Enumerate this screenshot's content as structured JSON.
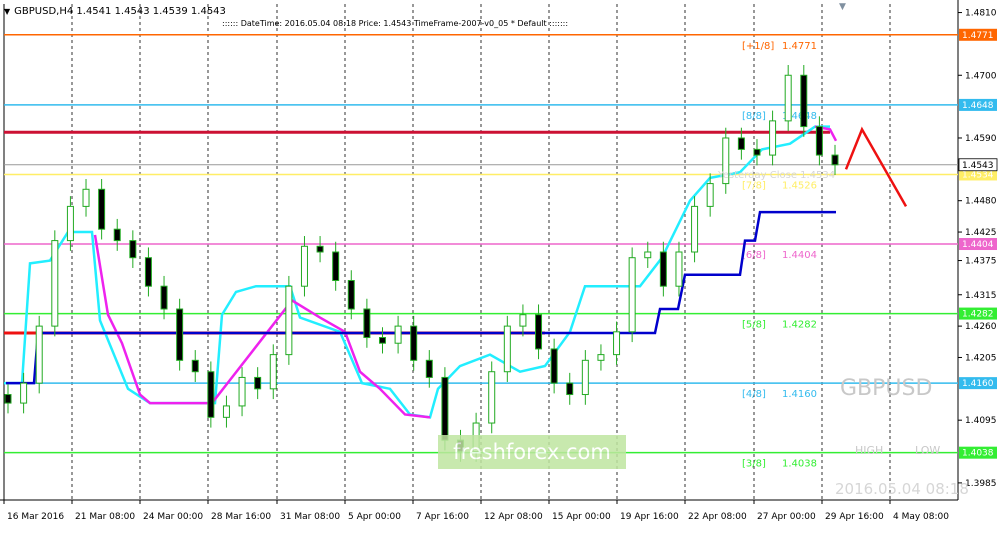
{
  "header": {
    "symbol_info": "GBPUSD,H4  1.4541 1.4543 1.4539 1.4543",
    "info_line": ":::::: DateTime: 2016.05.04 08:18   Price: 1.4543   TimeFrame-2007-v0_05   *   Default   :::::::"
  },
  "watermark": {
    "symbol": "GBPUSD",
    "timestamp": "2016.05.04 08:18",
    "high": "HIGH",
    "low": "LOW",
    "brand": "freshforex.com"
  },
  "price_axis": {
    "ticks": [
      "1.4810",
      "1.4700",
      "1.4590",
      "1.4480",
      "1.4375",
      "1.4315",
      "1.4260",
      "1.4205",
      "1.4095",
      "1.3985"
    ],
    "visible_ticks": [
      "1.4810",
      "1.4700",
      "1.4590",
      "1.4480",
      "1.4425",
      "1.4375",
      "1.4315",
      "1.4260",
      "1.4205",
      "1.4095",
      "1.3985"
    ]
  },
  "time_axis": {
    "labels": [
      "16 Mar 2016",
      "21 Mar 08:00",
      "24 Mar 00:00",
      "28 Mar 16:00",
      "31 Mar 08:00",
      "5 Apr 00:00",
      "7 Apr 16:00",
      "12 Apr 08:00",
      "15 Apr 00:00",
      "19 Apr 16:00",
      "22 Apr 08:00",
      "27 Apr 00:00",
      "29 Apr 16:00",
      "4 May 08:00"
    ]
  },
  "levels": [
    {
      "name": "[+1/8]",
      "value": "1.4771",
      "badge": "1.4771",
      "color": "#ff6600"
    },
    {
      "name": "[8/8]",
      "value": "1.4648",
      "badge": "1.4648",
      "color": "#33bbee"
    },
    {
      "name": "[7/8]",
      "value": "1.4526",
      "badge": "1.4534",
      "color": "#ffee66"
    },
    {
      "name": "[6/8]",
      "value": "1.4404",
      "badge": "1.4404",
      "color": "#ee66cc"
    },
    {
      "name": "[5/8]",
      "value": "1.4282",
      "badge": "1.4282",
      "color": "#33ee33"
    },
    {
      "name": "[4/8]",
      "value": "1.4160",
      "badge": "1.4160",
      "color": "#33bbee"
    },
    {
      "name": "[3/8]",
      "value": "1.4038",
      "badge": "1.4038",
      "color": "#33ee33"
    }
  ],
  "current_price_badge": "1.4543",
  "yesterday_close": "Yesterday Close 1.4534",
  "colors": {
    "candle": "#22aa22",
    "cyan_line": "#22eeff",
    "magenta_line": "#ee22ee",
    "red_line": "#ee1111",
    "blue_line": "#0000cc",
    "arrow": "#ee1111"
  },
  "chart_data": {
    "type": "candlestick",
    "symbol": "GBPUSD",
    "timeframe": "H4",
    "ylim": [
      1.3955,
      1.4825
    ],
    "last": {
      "open": 1.4541,
      "high": 1.4543,
      "low": 1.4539,
      "close": 1.4543
    },
    "series": [
      {
        "name": "close",
        "values": [
          1.4125,
          1.416,
          1.426,
          1.441,
          1.447,
          1.45,
          1.443,
          1.441,
          1.438,
          1.433,
          1.429,
          1.42,
          1.418,
          1.41,
          1.412,
          1.417,
          1.415,
          1.421,
          1.433,
          1.44,
          1.439,
          1.434,
          1.429,
          1.424,
          1.423,
          1.426,
          1.42,
          1.417,
          1.406,
          1.404,
          1.409,
          1.418,
          1.426,
          1.428,
          1.422,
          1.416,
          1.414,
          1.42,
          1.421,
          1.425,
          1.438,
          1.439,
          1.433,
          1.439,
          1.447,
          1.451,
          1.459,
          1.457,
          1.456,
          1.462,
          1.47,
          1.461,
          1.456,
          1.4543
        ]
      }
    ]
  }
}
